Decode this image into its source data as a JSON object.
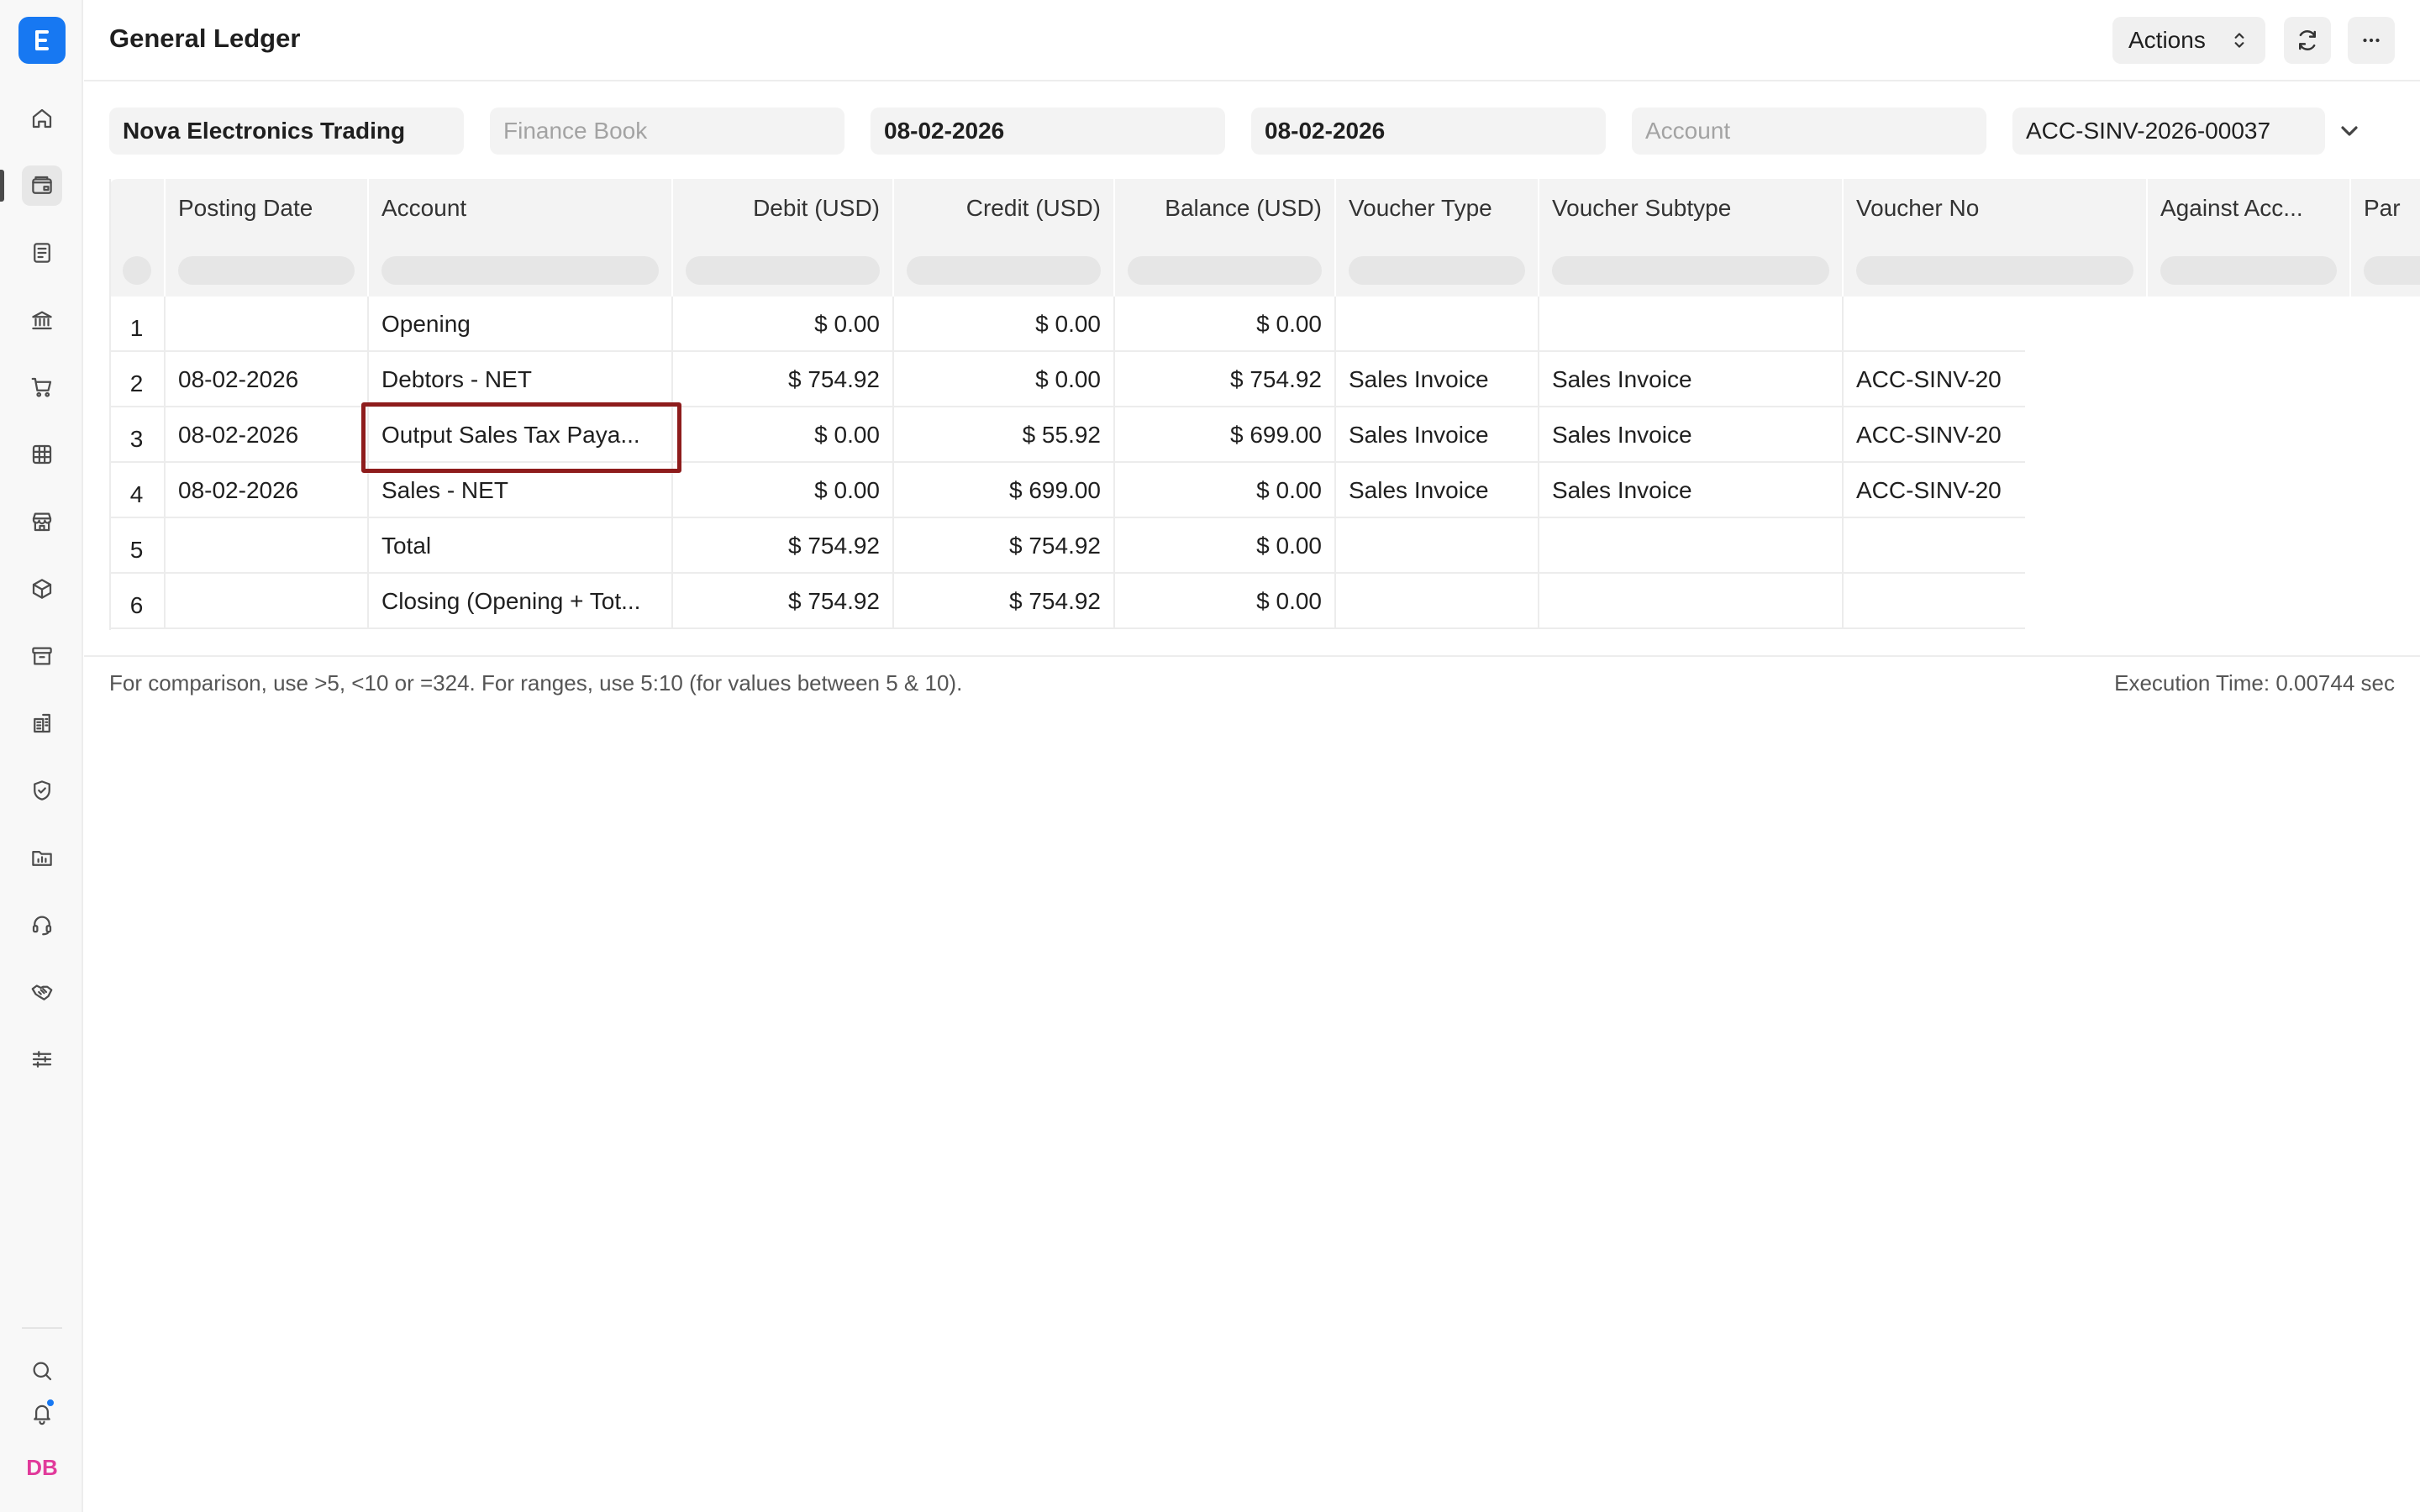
{
  "app": {
    "title": "General Ledger",
    "logo_letter": "E"
  },
  "sidebar": {
    "items": [
      {
        "name": "home-icon"
      },
      {
        "name": "accounting-icon",
        "active": true
      },
      {
        "name": "document-icon"
      },
      {
        "name": "bank-icon"
      },
      {
        "name": "cart-icon"
      },
      {
        "name": "table-icon"
      },
      {
        "name": "store-icon"
      },
      {
        "name": "package-icon"
      },
      {
        "name": "archive-icon"
      },
      {
        "name": "building-icon"
      },
      {
        "name": "shield-icon"
      },
      {
        "name": "folder-chart-icon"
      },
      {
        "name": "headset-icon"
      },
      {
        "name": "handshake-icon"
      },
      {
        "name": "sliders-icon"
      }
    ],
    "search_icon": "search-icon",
    "bell_icon": "bell-icon",
    "avatar_initials": "DB"
  },
  "toolbar": {
    "actions_label": "Actions",
    "refresh_icon": "refresh-icon",
    "more_icon": "more-icon"
  },
  "filters": {
    "company": "Nova Electronics Trading",
    "finance_book_placeholder": "Finance Book",
    "from_date": "08-02-2026",
    "to_date": "08-02-2026",
    "account_placeholder": "Account",
    "voucher_no": "ACC-SINV-2026-00037"
  },
  "table": {
    "columns": [
      "Posting Date",
      "Account",
      "Debit (USD)",
      "Credit (USD)",
      "Balance (USD)",
      "Voucher Type",
      "Voucher Subtype",
      "Voucher No",
      "Against Acc...",
      "Par"
    ],
    "rows": [
      {
        "idx": "1",
        "posting_date": "",
        "account": "Opening",
        "debit": "$ 0.00",
        "credit": "$ 0.00",
        "balance": "$ 0.00",
        "voucher_type": "",
        "voucher_subtype": "",
        "voucher_no": ""
      },
      {
        "idx": "2",
        "posting_date": "08-02-2026",
        "account": "Debtors - NET",
        "debit": "$ 754.92",
        "credit": "$ 0.00",
        "balance": "$ 754.92",
        "voucher_type": "Sales Invoice",
        "voucher_subtype": "Sales Invoice",
        "voucher_no": "ACC-SINV-20"
      },
      {
        "idx": "3",
        "posting_date": "08-02-2026",
        "account": "Output Sales Tax Paya...",
        "debit": "$ 0.00",
        "credit": "$ 55.92",
        "balance": "$ 699.00",
        "voucher_type": "Sales Invoice",
        "voucher_subtype": "Sales Invoice",
        "voucher_no": "ACC-SINV-20"
      },
      {
        "idx": "4",
        "posting_date": "08-02-2026",
        "account": "Sales - NET",
        "debit": "$ 0.00",
        "credit": "$ 699.00",
        "balance": "$ 0.00",
        "voucher_type": "Sales Invoice",
        "voucher_subtype": "Sales Invoice",
        "voucher_no": "ACC-SINV-20"
      },
      {
        "idx": "5",
        "posting_date": "",
        "account": "Total",
        "debit": "$ 754.92",
        "credit": "$ 754.92",
        "balance": "$ 0.00",
        "voucher_type": "",
        "voucher_subtype": "",
        "voucher_no": ""
      },
      {
        "idx": "6",
        "posting_date": "",
        "account": "Closing (Opening + Tot...",
        "debit": "$ 754.92",
        "credit": "$ 754.92",
        "balance": "$ 0.00",
        "voucher_type": "",
        "voucher_subtype": "",
        "voucher_no": ""
      }
    ]
  },
  "footer": {
    "note": "For comparison, use >5, <10 or =324. For ranges, use 5:10 (for values between 5 & 10).",
    "execution_time": "Execution Time: 0.00744 sec"
  },
  "colors": {
    "accent": "#1778f2",
    "highlight": "#8e1c1c",
    "avatar": "#e13a9b"
  }
}
